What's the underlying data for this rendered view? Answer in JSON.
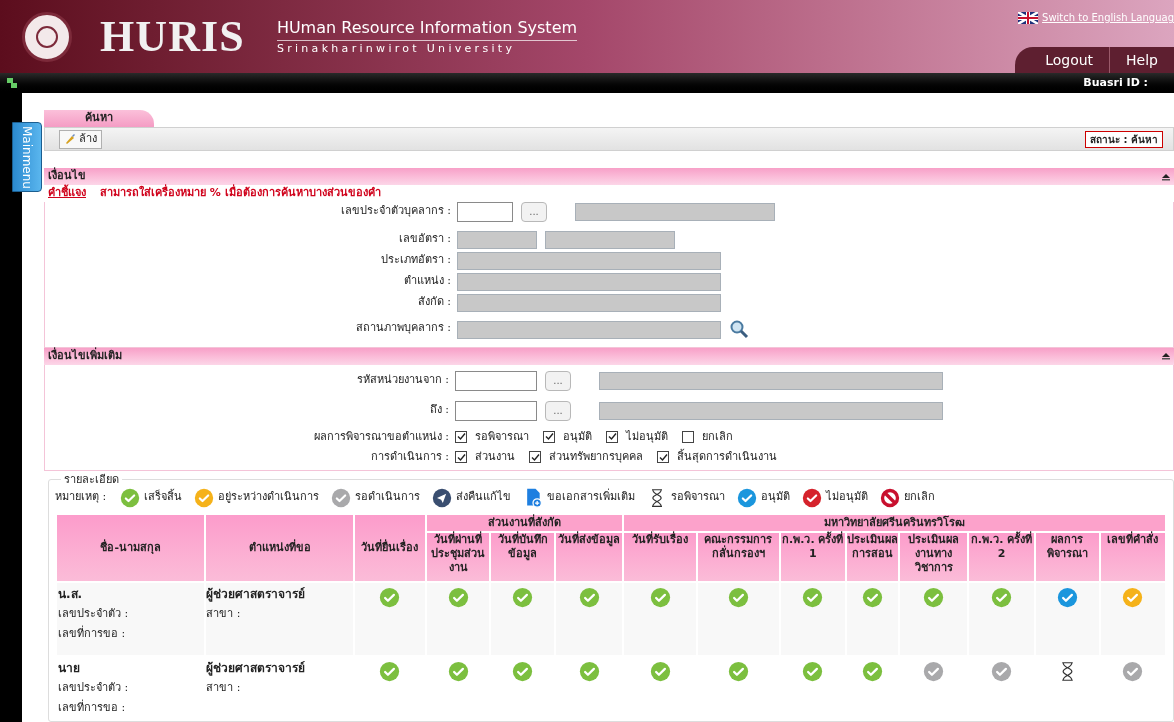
{
  "header": {
    "logo_text": "HURIS",
    "title": "HUman Resource Information System",
    "subtitle": "Srinakharinwirot University",
    "language_link": "Switch to English Languag",
    "buttons": [
      "Logout",
      "Help"
    ],
    "user_label": "Buasri ID :"
  },
  "side_tab": "Mainmenu",
  "tab": {
    "label": "ค้นหา",
    "selected": true
  },
  "toolbar": {
    "clear_button": "ล้าง",
    "status": "สถานะ : ค้นหา"
  },
  "conditions": {
    "title": "เงื่อนไข",
    "note_label": "คำชี้แจง",
    "note": "สามารถใส่เครื่องหมาย % เมื่อต้องการค้นหาบางส่วนของคำ",
    "fields": [
      {
        "label": "เลขประจำตัวบุคลากร :",
        "kind": "lookup",
        "browse": "..."
      },
      {
        "label": "เลขอัตรา :",
        "kind": "pair"
      },
      {
        "label": "ประเภทอัตรา :",
        "kind": "text"
      },
      {
        "label": "ตำแหน่ง :",
        "kind": "text"
      },
      {
        "label": "สังกัด :",
        "kind": "text"
      },
      {
        "label": "สถานภาพบุคลากร :",
        "kind": "text_search"
      }
    ]
  },
  "more_conditions": {
    "title": "เงื่อนไขเพิ่มเติม",
    "fields": [
      {
        "label": "รหัสหน่วยงานจาก :",
        "kind": "lookup",
        "browse": "..."
      },
      {
        "label": "ถึง :",
        "kind": "lookup",
        "browse": "..."
      }
    ],
    "check_groups": [
      {
        "label": "ผลการพิจารณาขอตำแหน่ง :",
        "options": [
          {
            "label": "รอพิจารณา",
            "checked": true
          },
          {
            "label": "อนุมัติ",
            "checked": true
          },
          {
            "label": "ไม่อนุมัติ",
            "checked": true
          },
          {
            "label": "ยกเลิก",
            "checked": false
          }
        ]
      },
      {
        "label": "การดำเนินการ :",
        "options": [
          {
            "label": "ส่วนงาน",
            "checked": true
          },
          {
            "label": "ส่วนทรัพยากรบุคคล",
            "checked": true
          },
          {
            "label": "สิ้นสุดการดำเนินงาน",
            "checked": true
          }
        ]
      }
    ]
  },
  "details": {
    "title": "รายละเอียด",
    "legend_label": "หมายเหตุ :",
    "legend": [
      {
        "kind": "done",
        "label": "เสร็จสิ้น"
      },
      {
        "kind": "in_progress",
        "label": "อยู่ระหว่างดำเนินการ"
      },
      {
        "kind": "pending",
        "label": "รอดำเนินการ"
      },
      {
        "kind": "returned",
        "label": "ส่งคืนแก้ไข"
      },
      {
        "kind": "request_docs",
        "label": "ขอเอกสารเพิ่มเติม"
      },
      {
        "kind": "awaiting",
        "label": "รอพิจารณา"
      },
      {
        "kind": "approved",
        "label": "อนุมัติ"
      },
      {
        "kind": "rejected",
        "label": "ไม่อนุมัติ"
      },
      {
        "kind": "cancelled",
        "label": "ยกเลิก"
      }
    ]
  },
  "table": {
    "columns": [
      "ชื่อ-นามสกุล",
      "ตำแหน่งที่ขอ",
      "วันที่ยื่นเรื่อง"
    ],
    "groups": [
      {
        "title": "ส่วนงานที่สังกัด",
        "columns": [
          "วันที่ผ่านที่ประชุมส่วนงาน",
          "วันที่บันทึกข้อมูล",
          "วันที่ส่งข้อมูล"
        ]
      },
      {
        "title": "มหาวิทยาลัยศรีนครินทรวิโรฒ",
        "columns": [
          "วันที่รับเรื่อง",
          "คณะกรรมการกลั่นกรองฯ",
          "ก.พ.ว. ครั้งที่ 1",
          "ประเมินผลการสอน",
          "ประเมินผลงานทางวิชาการ",
          "ก.พ.ว. ครั้งที่ 2",
          "ผลการพิจารณา",
          "เลขที่คำสั่ง"
        ]
      }
    ],
    "rows": [
      {
        "title": "น.ส.",
        "id_label": "เลขประจำตัว :",
        "request_label": "เลขที่การขอ :",
        "position": "ผู้ช่วยศาสตราจารย์",
        "branch_label": "สาขา :",
        "statuses": [
          {
            "kind": "done"
          },
          {
            "kind": "done"
          },
          {
            "kind": "done"
          },
          {
            "kind": "done"
          },
          {
            "kind": "done"
          },
          {
            "kind": "done"
          },
          {
            "kind": "done"
          },
          {
            "kind": "done"
          },
          {
            "kind": "done"
          },
          {
            "kind": "done"
          },
          {
            "kind": "approved"
          },
          {
            "kind": "in_progress"
          }
        ]
      },
      {
        "title": "นาย",
        "id_label": "เลขประจำตัว :",
        "request_label": "เลขที่การขอ :",
        "position": "ผู้ช่วยศาสตราจารย์",
        "branch_label": "สาขา :",
        "statuses": [
          {
            "kind": "done"
          },
          {
            "kind": "done"
          },
          {
            "kind": "done"
          },
          {
            "kind": "done"
          },
          {
            "kind": "done"
          },
          {
            "kind": "done"
          },
          {
            "kind": "done"
          },
          {
            "kind": "done"
          },
          {
            "kind": "pending"
          },
          {
            "kind": "pending"
          },
          {
            "kind": "awaiting"
          },
          {
            "kind": "pending"
          }
        ]
      }
    ]
  }
}
